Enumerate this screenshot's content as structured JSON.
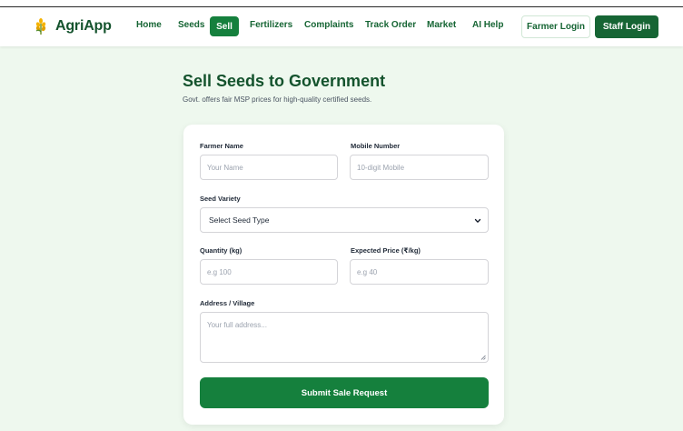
{
  "brand": {
    "name": "AgriApp",
    "icon": "wheat-icon"
  },
  "nav": {
    "home": "Home",
    "seeds": "Seeds",
    "sell": "Sell",
    "fertilizers": "Fertilizers",
    "complaints": "Complaints",
    "track_order": "Track Order",
    "market": "Market",
    "ai_help": "AI Help",
    "farmer_login": "Farmer Login",
    "staff_login": "Staff Login"
  },
  "page": {
    "title": "Sell Seeds to Government",
    "subtitle": "Govt. offers fair MSP prices for high-quality certified seeds."
  },
  "form": {
    "farmer_name": {
      "label": "Farmer Name",
      "placeholder": "Your Name"
    },
    "mobile": {
      "label": "Mobile Number",
      "placeholder": "10-digit Mobile"
    },
    "seed_variety": {
      "label": "Seed Variety",
      "selected": "Select Seed Type"
    },
    "quantity": {
      "label": "Quantity (kg)",
      "placeholder": "e.g 100"
    },
    "price": {
      "label": "Expected Price (₹/kg)",
      "placeholder": "e.g 40"
    },
    "address": {
      "label": "Address / Village",
      "placeholder": "Your full address..."
    },
    "submit_label": "Submit Sale Request"
  },
  "colors": {
    "primary": "#15803d",
    "dark_green": "#166534",
    "background": "#eef8ee"
  }
}
